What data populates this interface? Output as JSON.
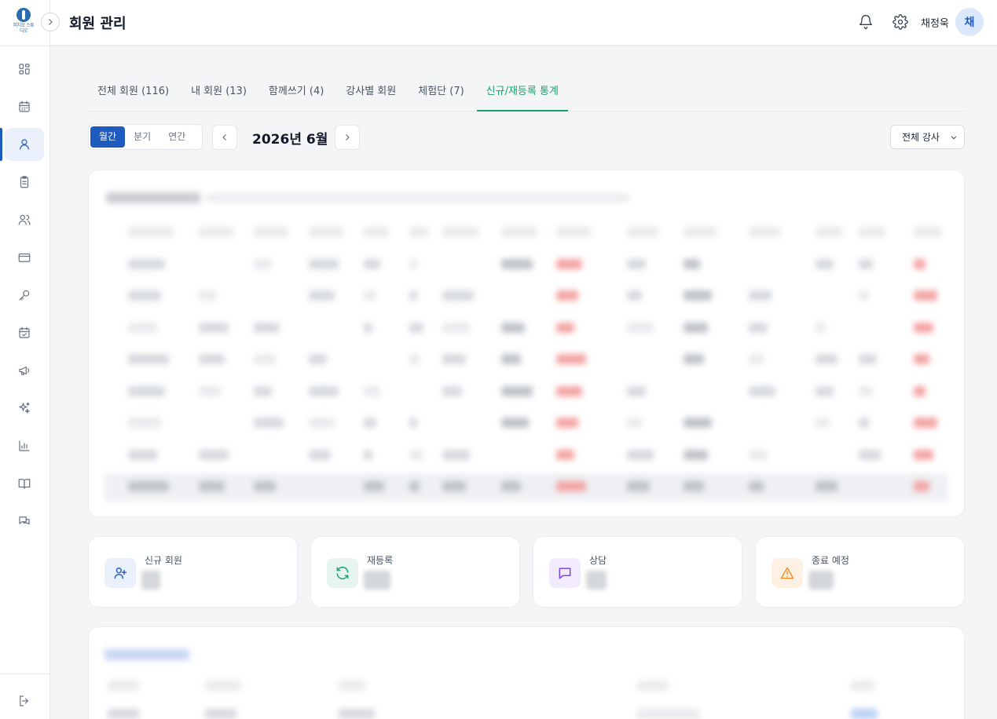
{
  "header": {
    "page_title": "회원 관리",
    "user_name": "채정욱",
    "avatar_initial": "채",
    "icons": [
      "bell-icon",
      "gear-icon"
    ]
  },
  "sidebar": {
    "logo_text": "피치오 스튜디오",
    "items": [
      {
        "icon": "dashboard-icon",
        "active": false
      },
      {
        "icon": "calendar-icon",
        "active": false
      },
      {
        "icon": "user-icon",
        "active": true
      },
      {
        "icon": "clipboard-icon",
        "active": false
      },
      {
        "icon": "users-icon",
        "active": false
      },
      {
        "icon": "card-icon",
        "active": false
      },
      {
        "icon": "key-icon",
        "active": false
      },
      {
        "icon": "calendar-check-icon",
        "active": false
      },
      {
        "icon": "megaphone-icon",
        "active": false
      },
      {
        "icon": "sparkles-icon",
        "active": false
      },
      {
        "icon": "bar-chart-icon",
        "active": false
      },
      {
        "icon": "book-icon",
        "active": false
      },
      {
        "icon": "chat-icon",
        "active": false
      }
    ],
    "logout_icon": "logout-icon"
  },
  "tabs": [
    {
      "label": "전체 회원 (116)",
      "active": false
    },
    {
      "label": "내 회원 (13)",
      "active": false
    },
    {
      "label": "함께쓰기 (4)",
      "active": false
    },
    {
      "label": "강사별 회원",
      "active": false
    },
    {
      "label": "체험단 (7)",
      "active": false
    },
    {
      "label": "신규/재등록 통계",
      "active": true
    }
  ],
  "period": {
    "options": [
      "월간",
      "분기",
      "연간"
    ],
    "selected": "월간",
    "label": "2026년 6월"
  },
  "instructor_filter": {
    "selected": "전체 강사"
  },
  "stats": [
    {
      "label": "신규 회원",
      "icon": "user-plus-icon",
      "color": "#1e5bbf"
    },
    {
      "label": "재등록",
      "icon": "refresh-icon",
      "color": "#1aa06d"
    },
    {
      "label": "상담",
      "icon": "message-icon",
      "color": "#7c3aed"
    },
    {
      "label": "종료 예정",
      "icon": "warning-icon",
      "color": "#f08a24"
    }
  ],
  "colors": {
    "primary": "#1e5bbf",
    "accent_tab": "#1aa06d"
  }
}
